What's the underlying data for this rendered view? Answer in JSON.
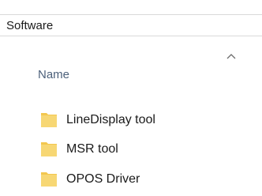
{
  "address_bar": {
    "path": "Software"
  },
  "column_header": {
    "name_label": "Name",
    "sort_indicator": "chevron-up-icon"
  },
  "files": [
    {
      "label": "LineDisplay tool",
      "icon": "folder-icon"
    },
    {
      "label": "MSR tool",
      "icon": "folder-icon"
    },
    {
      "label": "OPOS Driver",
      "icon": "folder-icon"
    }
  ],
  "colors": {
    "folder": "#f7d774",
    "folder_tab": "#f3c74f",
    "header_text": "#4c607a"
  }
}
